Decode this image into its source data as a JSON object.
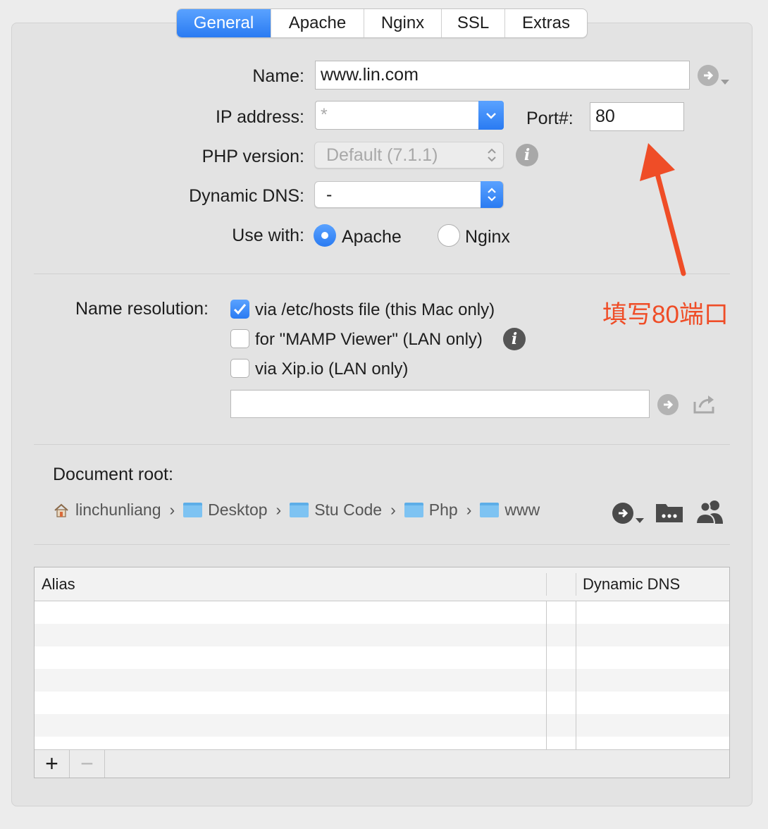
{
  "tabs": [
    "General",
    "Apache",
    "Nginx",
    "SSL",
    "Extras"
  ],
  "active_tab": "General",
  "form": {
    "name_label": "Name:",
    "name_value": "www.lin.com",
    "ip_label": "IP address:",
    "ip_value": "*",
    "port_label": "Port#:",
    "port_value": "80",
    "php_label": "PHP version:",
    "php_value": "Default (7.1.1)",
    "dns_label": "Dynamic DNS:",
    "dns_value": "-",
    "use_with_label": "Use with:",
    "use_apache": "Apache",
    "use_nginx": "Nginx",
    "use_with_selected": "Apache"
  },
  "resolution": {
    "label": "Name resolution:",
    "options": [
      {
        "label": "via /etc/hosts file (this Mac only)",
        "checked": true
      },
      {
        "label": "for \"MAMP Viewer\" (LAN only)",
        "checked": false
      },
      {
        "label": "via Xip.io (LAN only)",
        "checked": false
      }
    ],
    "url_value": ""
  },
  "document_root": {
    "label": "Document root:",
    "path": [
      "linchunliang",
      "Desktop",
      "Stu Code",
      "Php",
      "www"
    ]
  },
  "alias_table": {
    "headers": [
      "Alias",
      "",
      "Dynamic DNS"
    ],
    "add_label": "+",
    "remove_label": "−"
  },
  "annotation": {
    "text": "填写80端口",
    "color": "#ef4d27"
  },
  "colors": {
    "accent": "#2a7bf2",
    "annotation": "#ef4d27"
  }
}
